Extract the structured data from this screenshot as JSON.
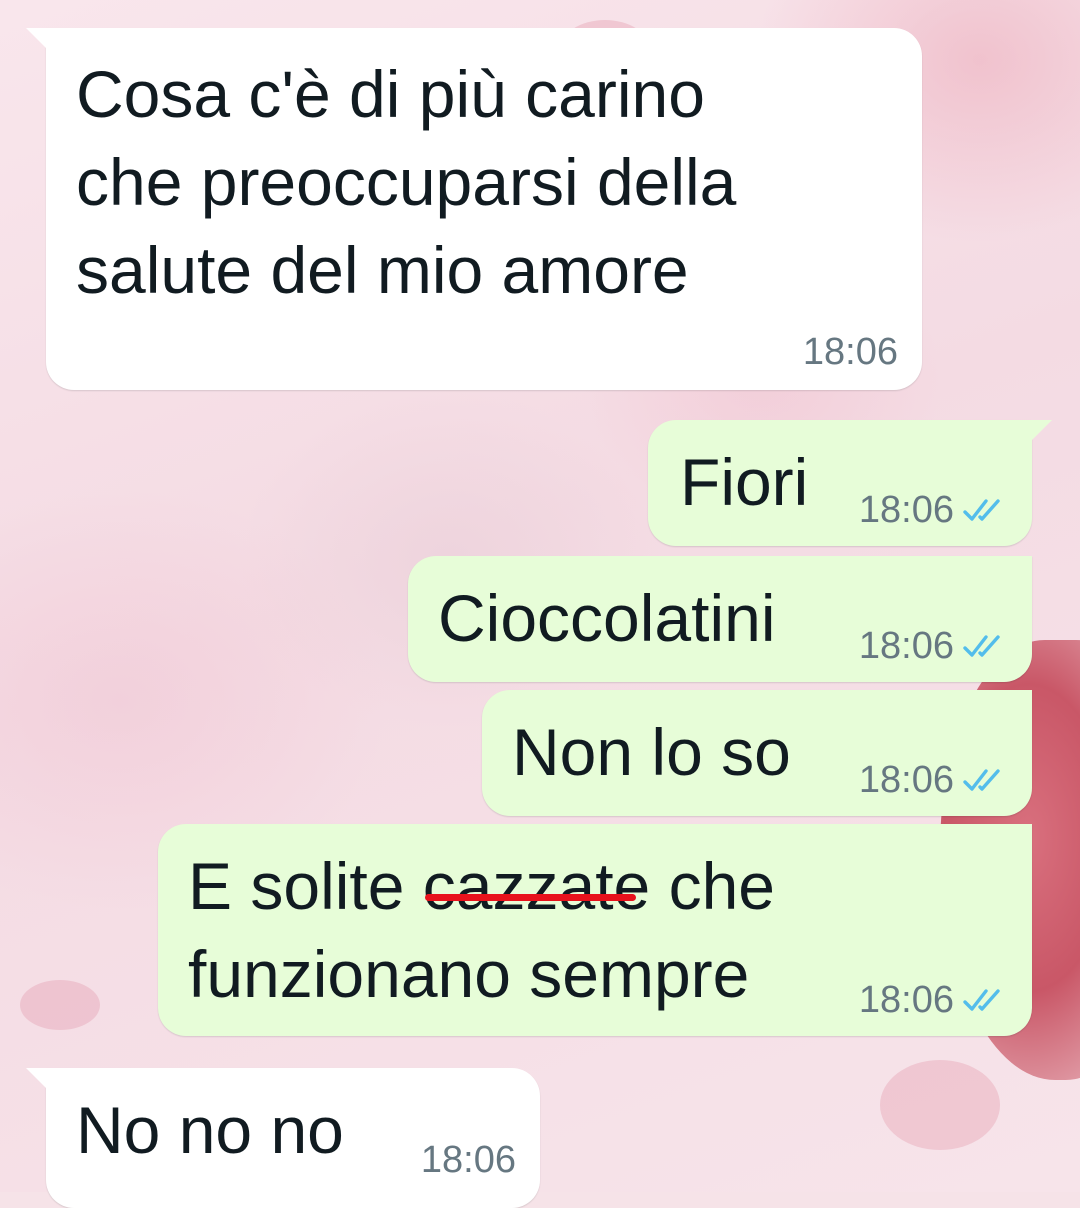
{
  "chat": {
    "messages": [
      {
        "direction": "incoming",
        "lines": [
          "Cosa c'è di più carino",
          "che preoccuparsi della",
          "salute del mio amore"
        ],
        "time": "18:06"
      },
      {
        "direction": "outgoing",
        "text": "Fiori",
        "time": "18:06",
        "status": "read"
      },
      {
        "direction": "outgoing",
        "text": "Cioccolatini",
        "time": "18:06",
        "status": "read"
      },
      {
        "direction": "outgoing",
        "text": "Non lo so",
        "time": "18:06",
        "status": "read"
      },
      {
        "direction": "outgoing",
        "line1_before": "E solite ",
        "line1_struck": "cazzate",
        "line1_after": " che",
        "line2": "funzionano sempre",
        "time": "18:06",
        "status": "read"
      },
      {
        "direction": "incoming",
        "text": "No no no",
        "time": "18:06"
      }
    ]
  },
  "colors": {
    "incoming_bubble": "#ffffff",
    "outgoing_bubble": "#e7fdd8",
    "read_ticks": "#53bdeb",
    "timestamp": "#667781",
    "strike_mark": "#e8121c"
  },
  "icons": {
    "read_status": "double-check-icon"
  }
}
